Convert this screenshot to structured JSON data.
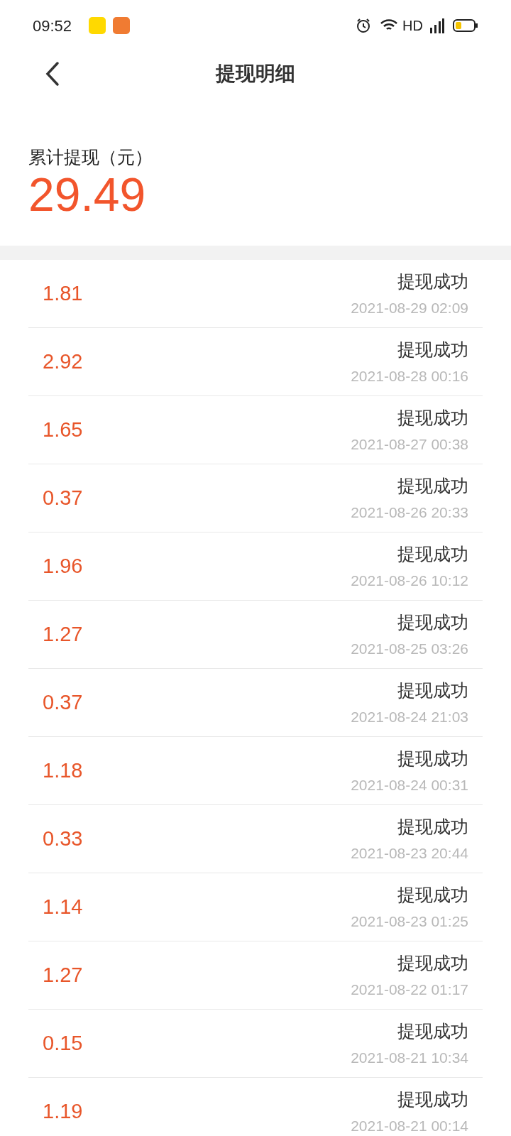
{
  "status_bar": {
    "time": "09:52",
    "network": "HD"
  },
  "header": {
    "title": "提现明细"
  },
  "summary": {
    "label": "累计提现（元）",
    "amount": "29.49"
  },
  "records": [
    {
      "amount": "1.81",
      "status": "提现成功",
      "time": "2021-08-29 02:09"
    },
    {
      "amount": "2.92",
      "status": "提现成功",
      "time": "2021-08-28 00:16"
    },
    {
      "amount": "1.65",
      "status": "提现成功",
      "time": "2021-08-27 00:38"
    },
    {
      "amount": "0.37",
      "status": "提现成功",
      "time": "2021-08-26 20:33"
    },
    {
      "amount": "1.96",
      "status": "提现成功",
      "time": "2021-08-26 10:12"
    },
    {
      "amount": "1.27",
      "status": "提现成功",
      "time": "2021-08-25 03:26"
    },
    {
      "amount": "0.37",
      "status": "提现成功",
      "time": "2021-08-24 21:03"
    },
    {
      "amount": "1.18",
      "status": "提现成功",
      "time": "2021-08-24 00:31"
    },
    {
      "amount": "0.33",
      "status": "提现成功",
      "time": "2021-08-23 20:44"
    },
    {
      "amount": "1.14",
      "status": "提现成功",
      "time": "2021-08-23 01:25"
    },
    {
      "amount": "1.27",
      "status": "提现成功",
      "time": "2021-08-22 01:17"
    },
    {
      "amount": "0.15",
      "status": "提现成功",
      "time": "2021-08-21 10:34"
    },
    {
      "amount": "1.19",
      "status": "提现成功",
      "time": "2021-08-21 00:14"
    }
  ]
}
